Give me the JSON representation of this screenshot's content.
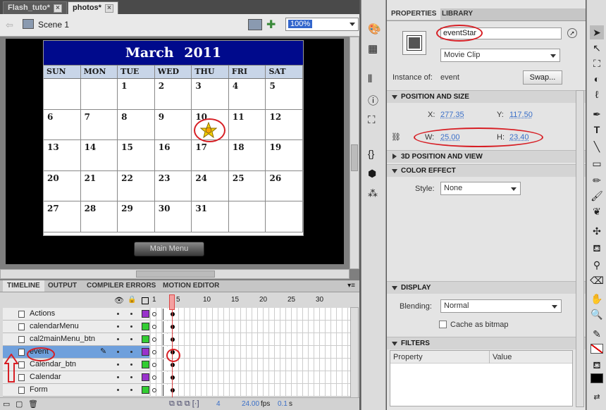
{
  "doc_tabs": [
    "Flash_tuto*",
    "photos*"
  ],
  "scene": "Scene 1",
  "zoom": "100%",
  "calendar": {
    "title": "March 2011",
    "days": [
      "SUN",
      "MON",
      "TUE",
      "WED",
      "THU",
      "FRI",
      "SAT"
    ],
    "weeks": [
      [
        "",
        "",
        "1",
        "2",
        "3",
        "4",
        "5"
      ],
      [
        "6",
        "7",
        "8",
        "9",
        "10",
        "11",
        "12"
      ],
      [
        "13",
        "14",
        "15",
        "16",
        "17",
        "18",
        "19"
      ],
      [
        "20",
        "21",
        "22",
        "23",
        "24",
        "25",
        "26"
      ],
      [
        "27",
        "28",
        "29",
        "30",
        "31",
        "",
        ""
      ]
    ]
  },
  "main_menu": "Main Menu",
  "panel_tabs": [
    "TIMELINE",
    "OUTPUT",
    "COMPILER ERRORS",
    "MOTION EDITOR"
  ],
  "frame_numbers": [
    "1",
    "5",
    "10",
    "15",
    "20",
    "25",
    "30"
  ],
  "layers": [
    {
      "name": "Actions",
      "color": "#9932cc"
    },
    {
      "name": "calendarMenu",
      "color": "#32cd32"
    },
    {
      "name": "cal2mainMenu_btn",
      "color": "#32cd32"
    },
    {
      "name": "event",
      "color": "#9932cc"
    },
    {
      "name": "Calendar_btn",
      "color": "#32cd32"
    },
    {
      "name": "Calendar",
      "color": "#9932cc"
    },
    {
      "name": "Form",
      "color": "#32cd32"
    }
  ],
  "timeline_status": {
    "frame": "4",
    "fps": "24.00",
    "fps_unit": "fps",
    "time": "0.1",
    "time_unit": "s"
  },
  "props": {
    "tabs": [
      "PROPERTIES",
      "LIBRARY"
    ],
    "instance_name": "eventStar",
    "symbol_type": "Movie Clip",
    "instance_of_label": "Instance of:",
    "instance_of": "event",
    "swap": "Swap...",
    "pos_size_label": "POSITION AND SIZE",
    "x_label": "X:",
    "x": "277.35",
    "y_label": "Y:",
    "y": "117.50",
    "w_label": "W:",
    "w": "25.00",
    "h_label": "H:",
    "h": "23.40",
    "pos3d_label": "3D POSITION AND VIEW",
    "color_label": "COLOR EFFECT",
    "style_label": "Style:",
    "style": "None",
    "display_label": "DISPLAY",
    "blending_label": "Blending:",
    "blending": "Normal",
    "cache_label": "Cache as bitmap",
    "filters_label": "FILTERS",
    "filter_cols": [
      "Property",
      "Value"
    ]
  }
}
